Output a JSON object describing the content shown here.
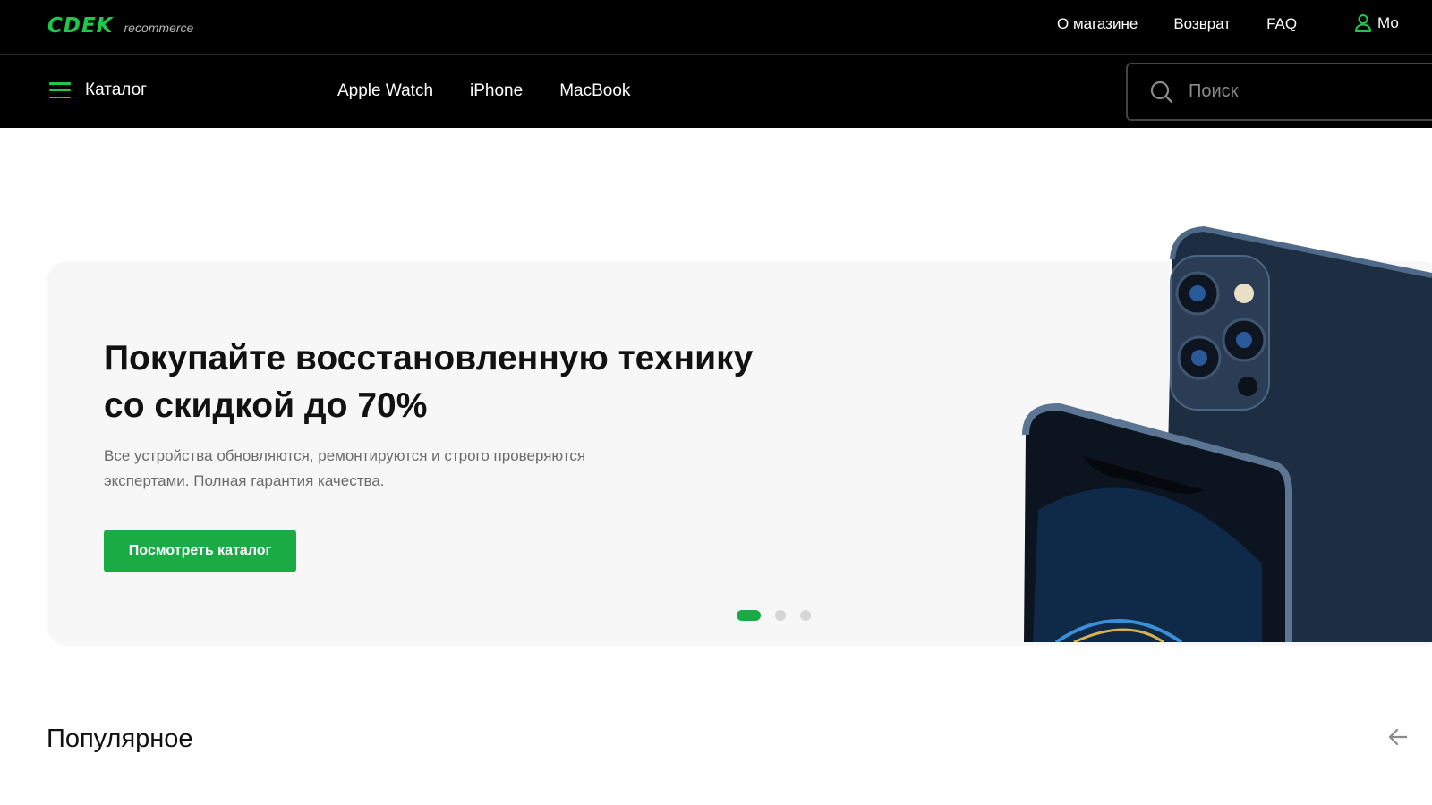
{
  "header": {
    "logo": "CDEK",
    "logo_sub": "recommerce",
    "nav": [
      {
        "label": "О магазине"
      },
      {
        "label": "Возврат"
      },
      {
        "label": "FAQ"
      }
    ],
    "account_label": "Мо"
  },
  "navbar": {
    "catalog_label": "Каталог",
    "links": [
      {
        "label": "Apple Watch"
      },
      {
        "label": "iPhone"
      },
      {
        "label": "MacBook"
      }
    ],
    "search_placeholder": "Поиск"
  },
  "hero": {
    "title_line1": "Покупайте восстановленную технику",
    "title_line2": "со скидкой до 70%",
    "text_line1": "Все устройства обновляются, ремонтируются и строго проверяются",
    "text_line2": "экспертами. Полная гарантия качества.",
    "cta": "Посмотреть каталог",
    "slides_total": 3,
    "active_slide": 1
  },
  "sections": {
    "popular_title": "Популярное"
  },
  "colors": {
    "brand_green": "#1ec84a",
    "button_green": "#1aab44",
    "header_bg": "#000000"
  },
  "icons": [
    "menu-icon",
    "search-icon",
    "user-icon",
    "arrow-left-icon"
  ]
}
